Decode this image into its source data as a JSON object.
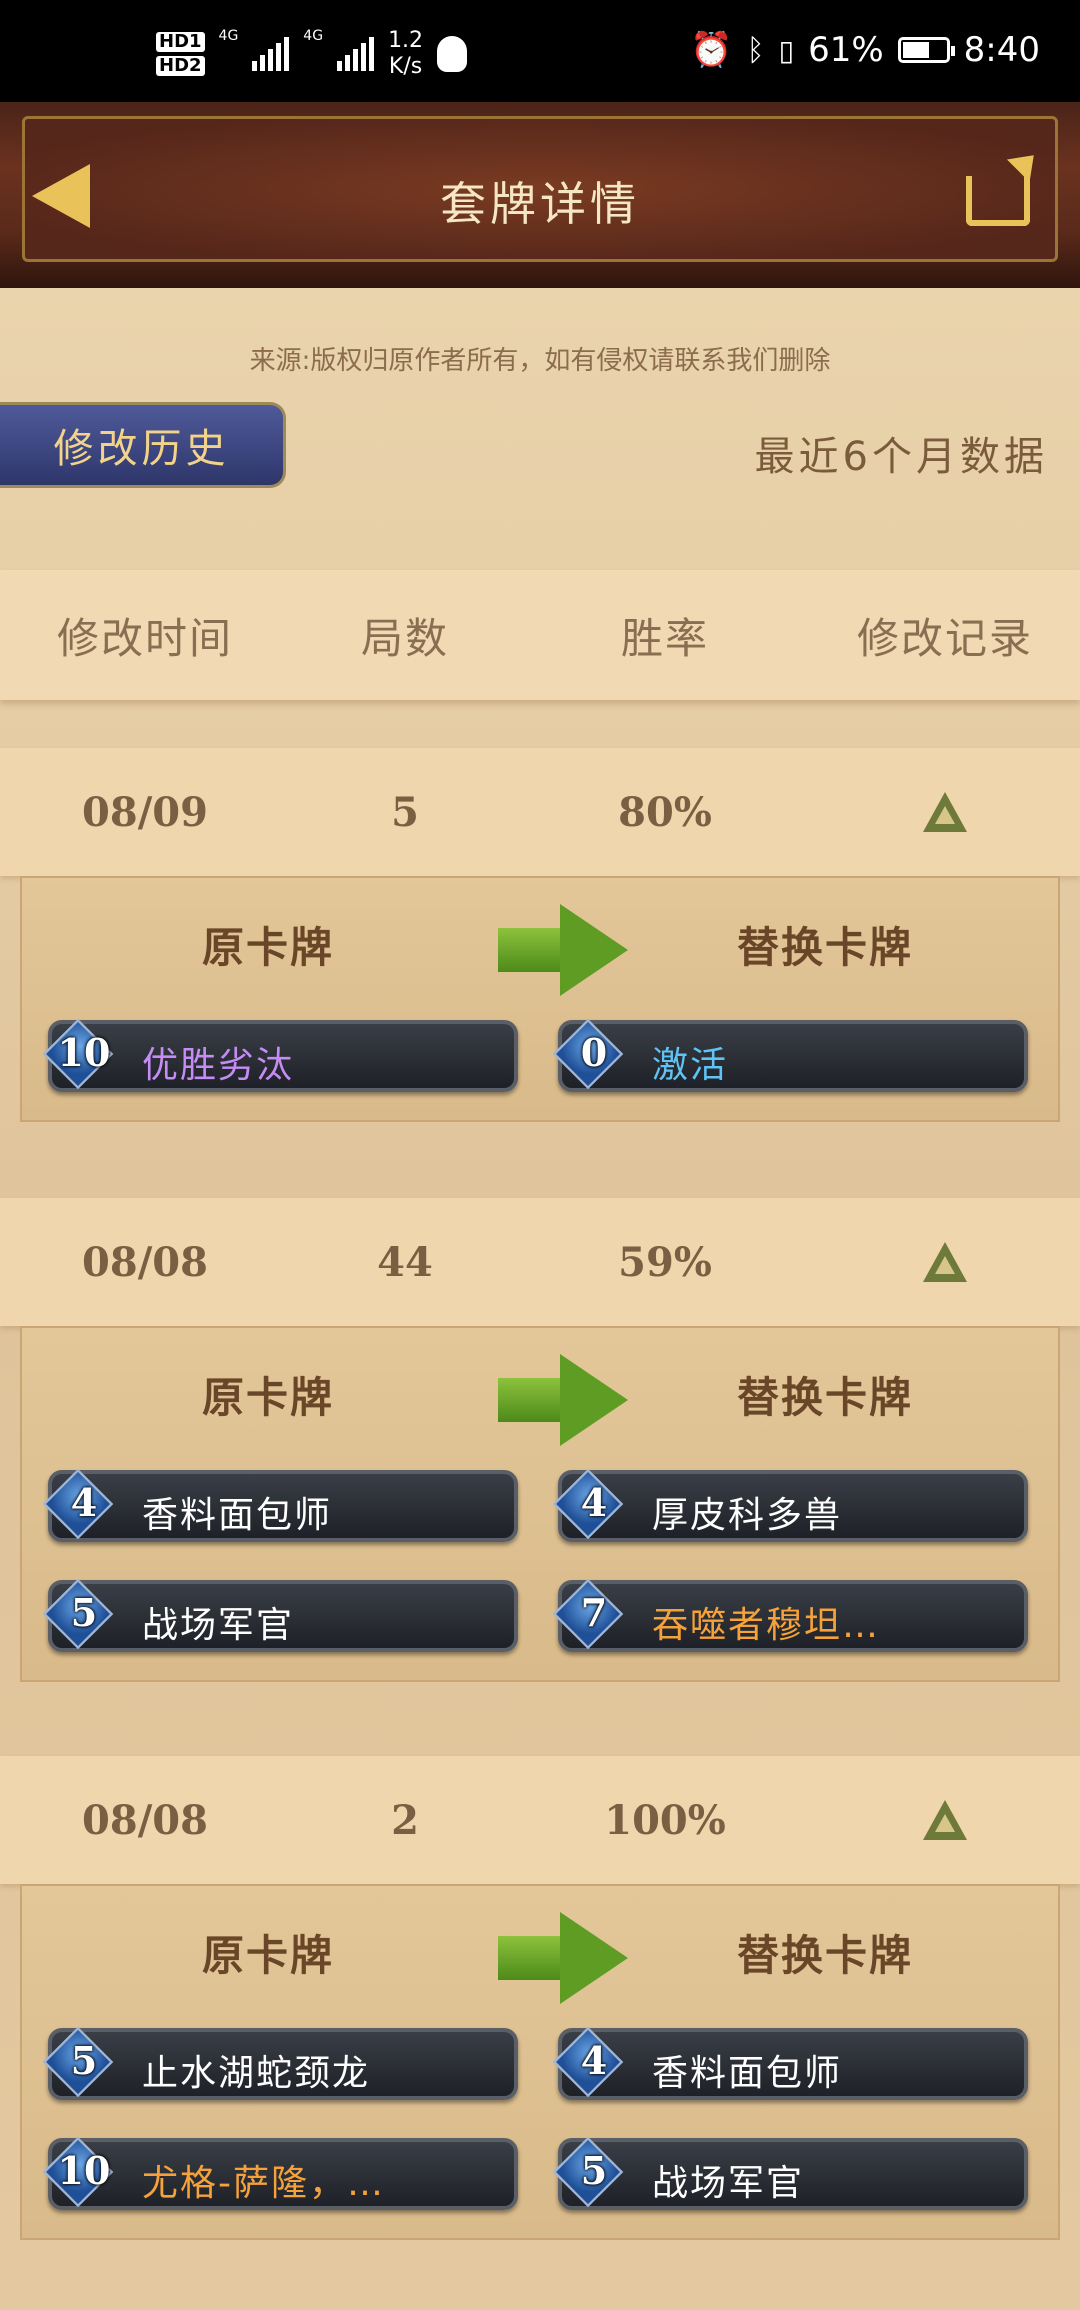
{
  "status_bar": {
    "hd1": "HD1",
    "hd2": "HD2",
    "net1": "4G",
    "net2": "4G",
    "speed_value": "1.2",
    "speed_unit": "K/s",
    "battery_pct": "61%",
    "battery_level": 0.61,
    "time": "8:40"
  },
  "header": {
    "title": "套牌详情",
    "back_icon": "back-arrow-icon",
    "share_icon": "share-icon"
  },
  "source_note": "来源:版权归原作者所有，如有侵权请联系我们删除",
  "history_tab": "修改历史",
  "period_label": "最近6个月数据",
  "table_headers": [
    "修改时间",
    "局数",
    "胜率",
    "修改记录"
  ],
  "labels": {
    "original": "原卡牌",
    "replacement": "替换卡牌"
  },
  "records": [
    {
      "date": "08/09",
      "games": "5",
      "winrate": "80%",
      "original": [
        {
          "cost": "10",
          "name": "优胜劣汰",
          "rarity": "epic"
        }
      ],
      "replacement": [
        {
          "cost": "0",
          "name": "激活",
          "rarity": "rare"
        }
      ]
    },
    {
      "date": "08/08",
      "games": "44",
      "winrate": "59%",
      "original": [
        {
          "cost": "4",
          "name": "香料面包师",
          "rarity": "common"
        },
        {
          "cost": "5",
          "name": "战场军官",
          "rarity": "common"
        }
      ],
      "replacement": [
        {
          "cost": "4",
          "name": "厚皮科多兽",
          "rarity": "common"
        },
        {
          "cost": "7",
          "name": "吞噬者穆坦…",
          "rarity": "legendary"
        }
      ]
    },
    {
      "date": "08/08",
      "games": "2",
      "winrate": "100%",
      "original": [
        {
          "cost": "5",
          "name": "止水湖蛇颈龙",
          "rarity": "common"
        },
        {
          "cost": "10",
          "name": "尤格-萨隆，…",
          "rarity": "legendary"
        }
      ],
      "replacement": [
        {
          "cost": "4",
          "name": "香料面包师",
          "rarity": "common"
        },
        {
          "cost": "5",
          "name": "战场军官",
          "rarity": "common"
        }
      ]
    }
  ]
}
